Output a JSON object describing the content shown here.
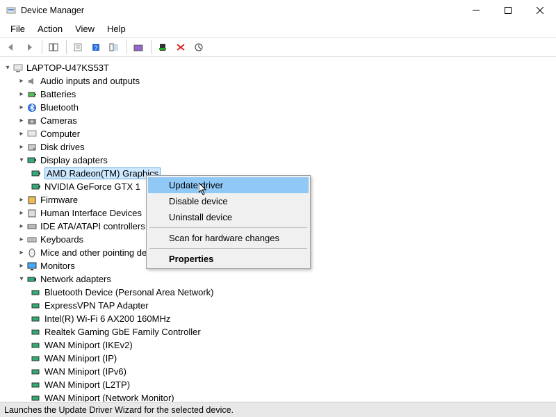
{
  "window": {
    "title": "Device Manager"
  },
  "menus": {
    "file": "File",
    "action": "Action",
    "view": "View",
    "help": "Help"
  },
  "tree": {
    "root": "LAPTOP-U47KS53T",
    "c0": {
      "label": "Audio inputs and outputs",
      "expanded": false
    },
    "c1": {
      "label": "Batteries",
      "expanded": false
    },
    "c2": {
      "label": "Bluetooth",
      "expanded": false
    },
    "c3": {
      "label": "Cameras",
      "expanded": false
    },
    "c4": {
      "label": "Computer",
      "expanded": false
    },
    "c5": {
      "label": "Disk drives",
      "expanded": false
    },
    "c6": {
      "label": "Display adapters",
      "expanded": true
    },
    "c6a": {
      "label": "AMD Radeon(TM) Graphics"
    },
    "c6b": {
      "label": "NVIDIA GeForce GTX 1"
    },
    "c7": {
      "label": "Firmware",
      "expanded": false
    },
    "c8": {
      "label": "Human Interface Devices",
      "expanded": false
    },
    "c9": {
      "label": "IDE ATA/ATAPI controllers",
      "expanded": false
    },
    "c10": {
      "label": "Keyboards",
      "expanded": false
    },
    "c11": {
      "label": "Mice and other pointing devices",
      "expanded": false
    },
    "c12": {
      "label": "Monitors",
      "expanded": false
    },
    "c13": {
      "label": "Network adapters",
      "expanded": true
    },
    "c13a": {
      "label": "Bluetooth Device (Personal Area Network)"
    },
    "c13b": {
      "label": "ExpressVPN TAP Adapter"
    },
    "c13c": {
      "label": "Intel(R) Wi-Fi 6 AX200 160MHz"
    },
    "c13d": {
      "label": "Realtek Gaming GbE Family Controller"
    },
    "c13e": {
      "label": "WAN Miniport (IKEv2)"
    },
    "c13f": {
      "label": "WAN Miniport (IP)"
    },
    "c13g": {
      "label": "WAN Miniport (IPv6)"
    },
    "c13h": {
      "label": "WAN Miniport (L2TP)"
    },
    "c13i": {
      "label": "WAN Miniport (Network Monitor)"
    }
  },
  "context_menu": {
    "update": "Update driver",
    "disable": "Disable device",
    "uninstall": "Uninstall device",
    "scan": "Scan for hardware changes",
    "properties": "Properties"
  },
  "statusbar": "Launches the Update Driver Wizard for the selected device."
}
